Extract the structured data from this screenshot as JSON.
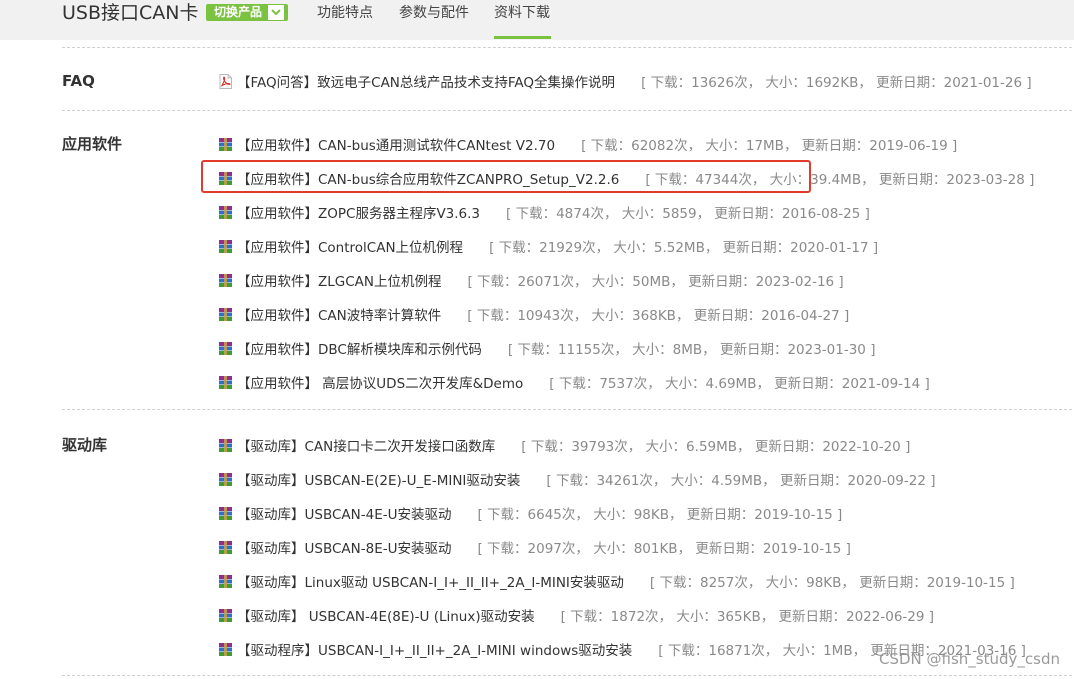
{
  "header": {
    "product_title": "USB接口CAN卡",
    "switch_label": "切换产品",
    "tabs": [
      {
        "label": "功能特点"
      },
      {
        "label": "参数与配件"
      },
      {
        "label": "资料下载"
      }
    ]
  },
  "sections": {
    "faq": {
      "label": "FAQ",
      "items": [
        {
          "title": "【FAQ问答】致远电子CAN总线产品技术支持FAQ全集操作说明",
          "meta": "[ 下载：13626次， 大小：1692KB， 更新日期：2021-01-26 ]"
        }
      ]
    },
    "software": {
      "label": "应用软件",
      "items": [
        {
          "title": "【应用软件】CAN-bus通用测试软件CANtest V2.70",
          "meta": "[ 下载：62082次， 大小：17MB， 更新日期：2019-06-19 ]"
        },
        {
          "title": "【应用软件】CAN-bus综合应用软件ZCANPRO_Setup_V2.2.6",
          "meta": "[ 下载：47344次， 大小：39.4MB， 更新日期：2023-03-28 ]"
        },
        {
          "title": "【应用软件】ZOPC服务器主程序V3.6.3",
          "meta": "[ 下载：4874次， 大小：5859， 更新日期：2016-08-25 ]"
        },
        {
          "title": "【应用软件】ControlCAN上位机例程",
          "meta": "[ 下载：21929次， 大小：5.52MB， 更新日期：2020-01-17 ]"
        },
        {
          "title": "【应用软件】ZLGCAN上位机例程",
          "meta": "[ 下载：26071次， 大小：50MB， 更新日期：2023-02-16 ]"
        },
        {
          "title": "【应用软件】CAN波特率计算软件",
          "meta": "[ 下载：10943次， 大小：368KB， 更新日期：2016-04-27 ]"
        },
        {
          "title": "【应用软件】DBC解析模块库和示例代码",
          "meta": "[ 下载：11155次， 大小：8MB， 更新日期：2023-01-30 ]"
        },
        {
          "title": "【应用软件】 高层协议UDS二次开发库&Demo",
          "meta": "[ 下载：7537次， 大小：4.69MB， 更新日期：2021-09-14 ]"
        }
      ]
    },
    "drivers": {
      "label": "驱动库",
      "items": [
        {
          "title": "【驱动库】CAN接口卡二次开发接口函数库",
          "meta": "[ 下载：39793次， 大小：6.59MB， 更新日期：2022-10-20 ]"
        },
        {
          "title": "【驱动库】USBCAN-E(2E)-U_E-MINI驱动安装",
          "meta": "[ 下载：34261次， 大小：4.59MB， 更新日期：2020-09-22 ]"
        },
        {
          "title": "【驱动库】USBCAN-4E-U安装驱动",
          "meta": "[ 下载：6645次， 大小：98KB， 更新日期：2019-10-15 ]"
        },
        {
          "title": "【驱动库】USBCAN-8E-U安装驱动",
          "meta": "[ 下载：2097次， 大小：801KB， 更新日期：2019-10-15 ]"
        },
        {
          "title": "【驱动库】Linux驱动 USBCAN-I_I+_II_II+_2A_I-MINI安装驱动",
          "meta": "[ 下载：8257次， 大小：98KB， 更新日期：2019-10-15 ]"
        },
        {
          "title": "【驱动库】 USBCAN-4E(8E)-U (Linux)驱动安装",
          "meta": "[ 下载：1872次， 大小：365KB， 更新日期：2022-06-29 ]"
        },
        {
          "title": "【驱动程序】USBCAN-I_I+_II_II+_2A_I-MINI windows驱动安装",
          "meta": "[ 下载：16871次， 大小：1MB， 更新日期：2021-03-16 ]"
        }
      ]
    }
  },
  "watermark": "CSDN @fish_study_csdn",
  "colors": {
    "accent": "#7cc242",
    "highlight": "#e23b2e",
    "meta": "#8a8a8a"
  },
  "icons": {
    "faq": "pdf-icon",
    "file": "winrar-archive-icon"
  }
}
